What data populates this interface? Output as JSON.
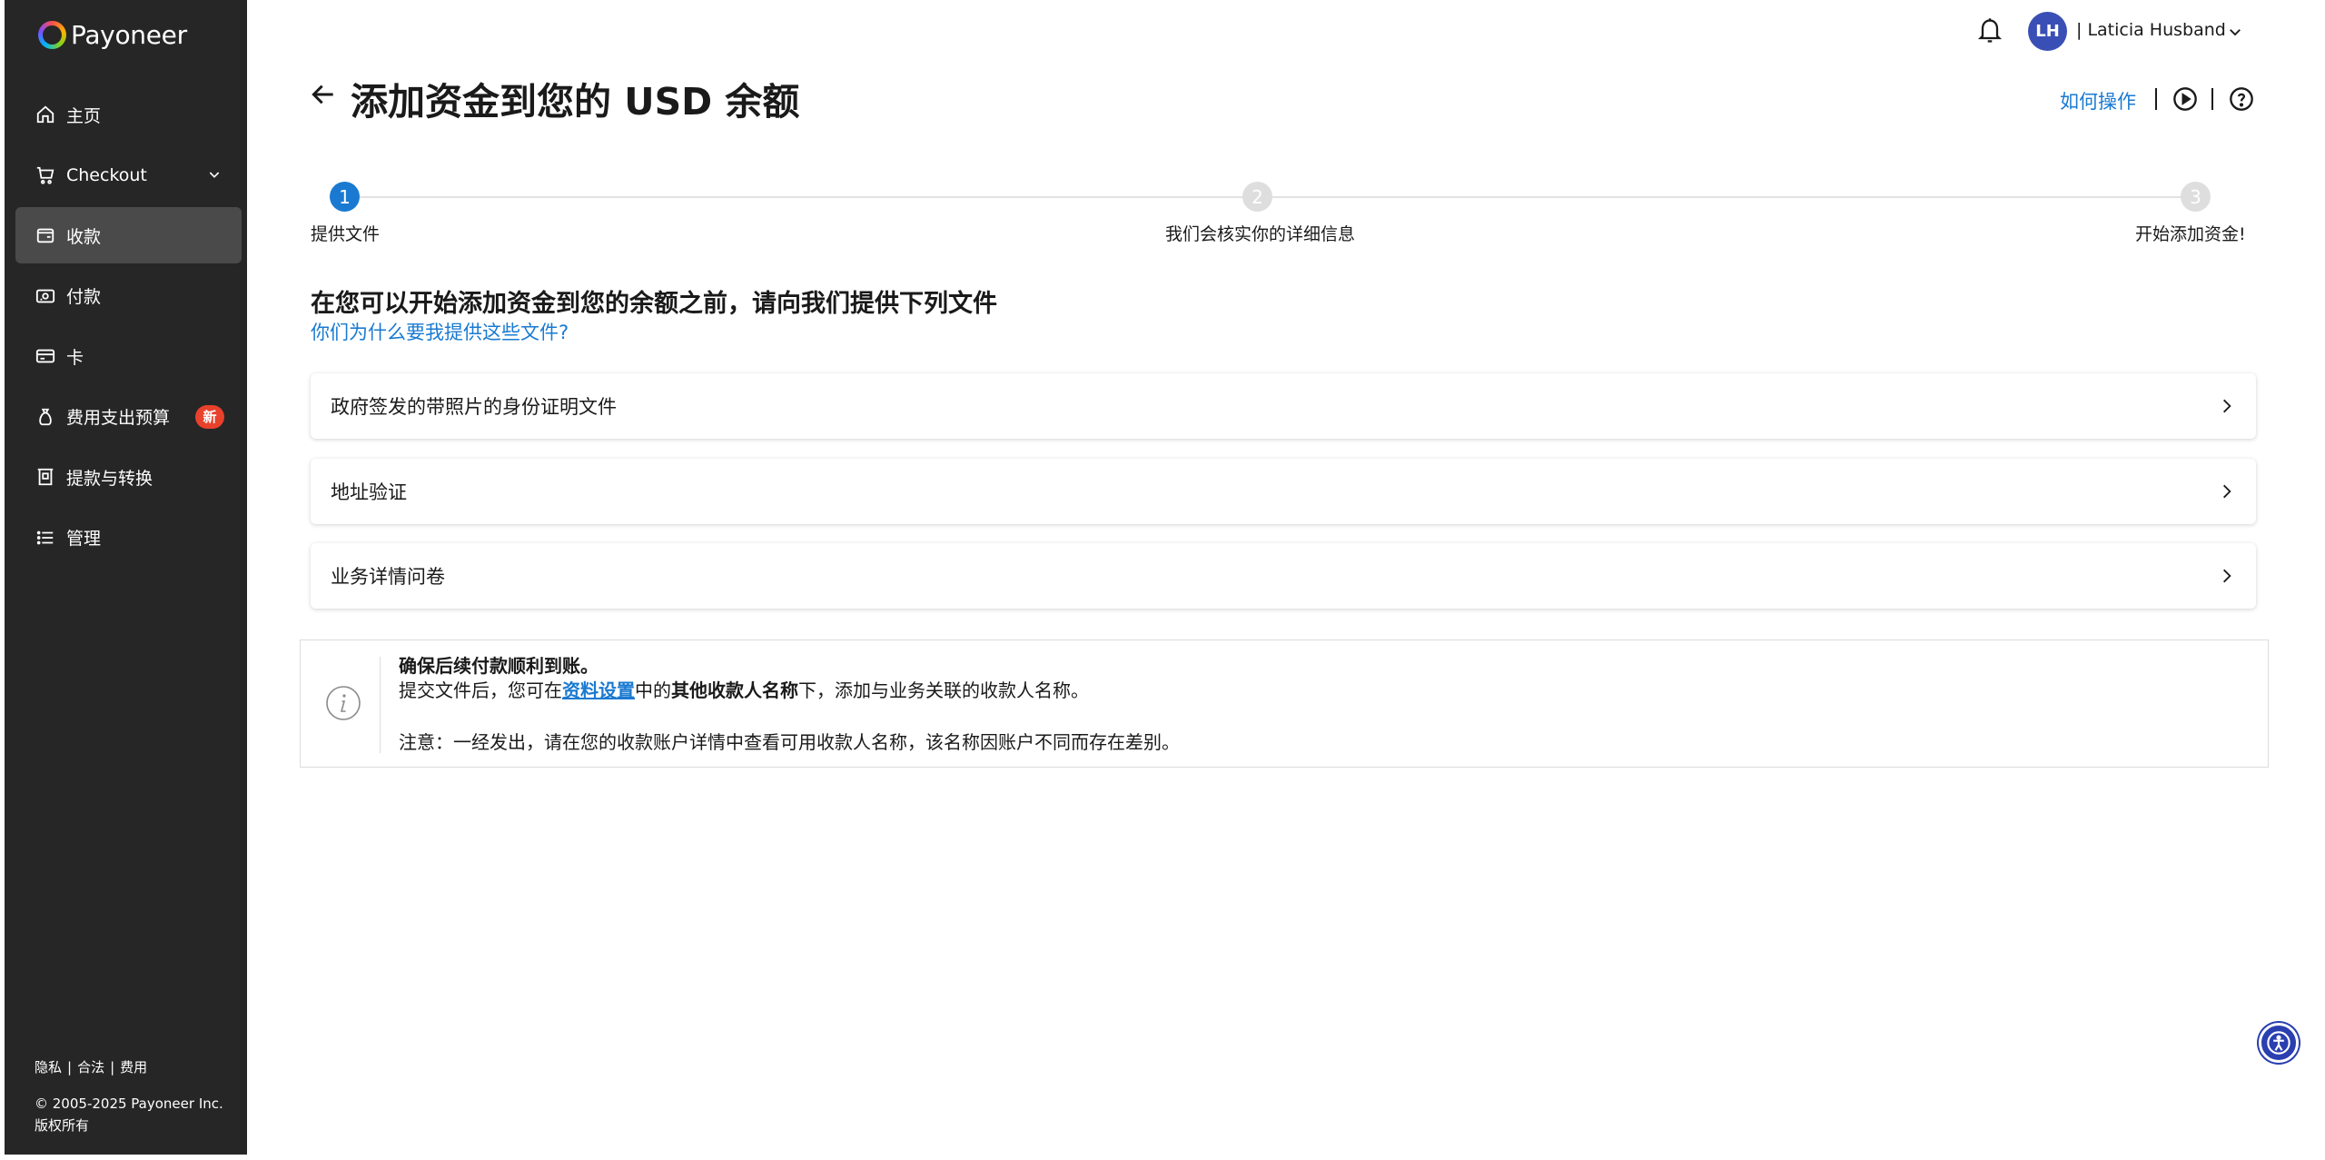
{
  "brand": {
    "name": "Payoneer"
  },
  "sidebar": {
    "items": [
      {
        "label": "主页",
        "icon": "home-icon"
      },
      {
        "label": "Checkout",
        "icon": "cart-icon"
      },
      {
        "label": "收款",
        "icon": "wallet-icon"
      },
      {
        "label": "付款",
        "icon": "cash-icon"
      },
      {
        "label": "卡",
        "icon": "card-icon"
      },
      {
        "label": "费用支出预算",
        "icon": "money-bag-icon",
        "badge": "新"
      },
      {
        "label": "提款与转换",
        "icon": "withdraw-icon"
      },
      {
        "label": "管理",
        "icon": "list-icon"
      }
    ],
    "footer": {
      "privacy": "隐私",
      "legal": "合法",
      "fees": "费用",
      "sep": "|",
      "copyright": "© 2005-2025 Payoneer Inc.",
      "rights": "版权所有"
    }
  },
  "header": {
    "avatar_initials": "LH",
    "user_name": "| Laticia Husband"
  },
  "page": {
    "title": "添加资金到您的 USD 余额",
    "howto": "如何操作"
  },
  "stepper": {
    "steps": [
      {
        "number": "1",
        "label": "提供文件",
        "state": "active"
      },
      {
        "number": "2",
        "label": "我们会核实你的详细信息",
        "state": "todo"
      },
      {
        "number": "3",
        "label": "开始添加资金!",
        "state": "todo"
      }
    ]
  },
  "documents": {
    "heading": "在您可以开始添加资金到您的余额之前，请向我们提供下列文件",
    "why_link": "你们为什么要我提供这些文件?",
    "items": [
      {
        "label": "政府签发的带照片的身份证明文件"
      },
      {
        "label": "地址验证"
      },
      {
        "label": "业务详情问卷"
      }
    ]
  },
  "info": {
    "title": "确保后续付款顺利到账。",
    "line_prefix": "提交文件后，您可在",
    "link": "资料设置",
    "line_mid_bold": "中的其他收款人名称下",
    "line_suffix": "，添加与业务关联的收款人名称。",
    "note": "注意：一经发出，请在您的收款账户详情中查看可用收款人名称，该名称因账户不同而存在差别。"
  },
  "colors": {
    "sidebar_bg": "#262626",
    "active_item_bg": "#4a4a4a",
    "accent_blue": "#1a7ad1",
    "badge_red": "#e8412c",
    "avatar_bg": "#3a4fb5"
  }
}
